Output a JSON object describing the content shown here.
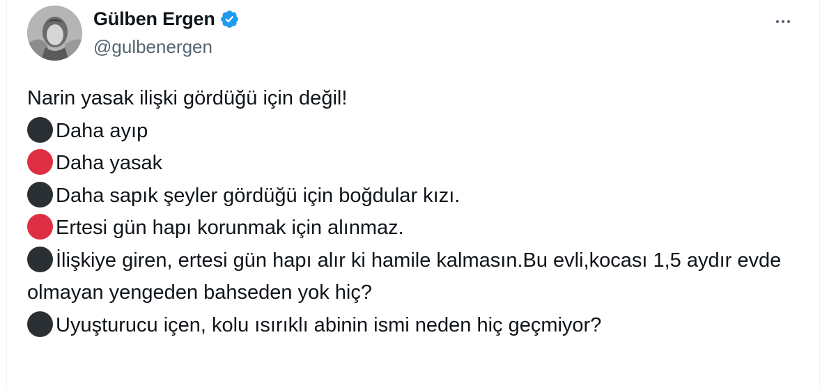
{
  "author": {
    "name": "Gülben Ergen",
    "handle": "@gulbenergen",
    "verified_color": "#1d9bf0"
  },
  "more_button": {
    "icon": "more-horizontal-icon"
  },
  "tweet": {
    "intro": "Narin yasak ilişki gördüğü için değil!",
    "items": [
      {
        "dot": "#292f33",
        "text": "Daha ayıp"
      },
      {
        "dot": "#dd2e44",
        "text": "Daha yasak"
      },
      {
        "dot": "#292f33",
        "text": "Daha sapık şeyler gördüğü için boğdular kızı."
      },
      {
        "dot": "#dd2e44",
        "text": "Ertesi gün hapı korunmak için alınmaz."
      },
      {
        "dot": "#292f33",
        "text": "İlişkiye giren, ertesi gün hapı alır ki hamile kalmasın.Bu evli,kocası 1,5 aydır evde olmayan yengeden bahseden yok hiç?"
      },
      {
        "dot": "#292f33",
        "text": "Uyuşturucu içen, kolu ısırıklı abinin ismi neden hiç geçmiyor?"
      }
    ]
  }
}
